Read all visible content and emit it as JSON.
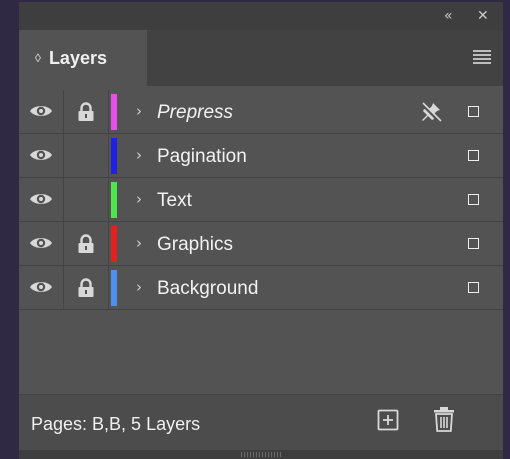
{
  "window": {
    "collapse_glyph": "«",
    "close_glyph": "✕"
  },
  "tab": {
    "arrows_glyph": "◊",
    "label": "Layers"
  },
  "panel_menu_icon": "hamburger-menu-icon",
  "layers": [
    {
      "name": "Prepress",
      "color": "#e650e6",
      "visible": true,
      "locked": true,
      "italic": true,
      "nonprinting": true
    },
    {
      "name": "Pagination",
      "color": "#1f1fe6",
      "visible": true,
      "locked": false,
      "italic": false,
      "nonprinting": false
    },
    {
      "name": "Text",
      "color": "#4ee64e",
      "visible": true,
      "locked": false,
      "italic": false,
      "nonprinting": false
    },
    {
      "name": "Graphics",
      "color": "#e61f1f",
      "visible": true,
      "locked": true,
      "italic": false,
      "nonprinting": false
    },
    {
      "name": "Background",
      "color": "#4f8ff0",
      "visible": true,
      "locked": true,
      "italic": false,
      "nonprinting": false
    }
  ],
  "chevron_glyph": "›",
  "footer": {
    "status": "Pages: B,B, 5 Layers",
    "new_layer_icon": "new-layer-icon",
    "delete_icon": "trash-icon"
  }
}
